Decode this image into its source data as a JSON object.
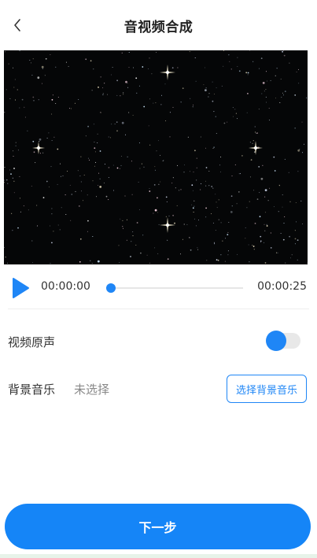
{
  "header": {
    "title": "音视频合成",
    "back_icon": "chevron-left-icon"
  },
  "video": {
    "preview_icon": "starfield-video-frame"
  },
  "player": {
    "current_time": "00:00:00",
    "total_time": "00:00:25",
    "progress": 0,
    "play_icon": "play-icon"
  },
  "original_audio": {
    "label": "视频原声",
    "enabled": true
  },
  "background_music": {
    "label": "背景音乐",
    "value": "未选择",
    "button_label": "选择背景音乐"
  },
  "footer": {
    "next_label": "下一步"
  },
  "colors": {
    "accent": "#1585f7",
    "video_bg": "#050607",
    "text": "#333333",
    "muted": "#888888"
  }
}
